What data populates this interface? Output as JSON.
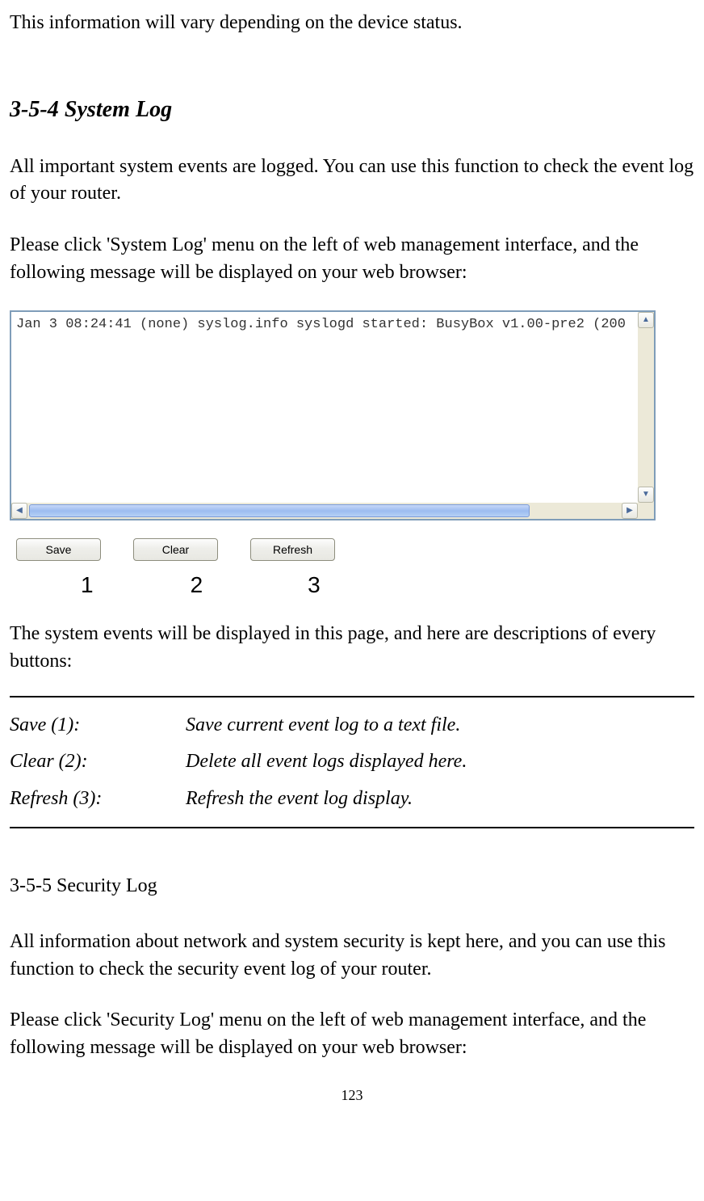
{
  "introText": "This information will vary depending on the device status.",
  "section1": {
    "heading": "3-5-4 System Log",
    "para1": "All important system events are logged. You can use this function to check the event log of your router.",
    "para2": "Please click 'System Log' menu on the left of web management interface, and the following message will be displayed on your web browser:"
  },
  "logContent": "Jan  3 08:24:41 (none) syslog.info syslogd started: BusyBox v1.00-pre2 (200",
  "buttons": {
    "save": "Save",
    "clear": "Clear",
    "refresh": "Refresh"
  },
  "annotations": {
    "n1": "1",
    "n2": "2",
    "n3": "3"
  },
  "descIntro": "The system events will be displayed in this page, and here are descriptions of every buttons:",
  "descriptions": [
    {
      "label": "Save (1):",
      "text": "Save current event log to a text file."
    },
    {
      "label": "Clear (2):",
      "text": "Delete all event logs displayed here."
    },
    {
      "label": "Refresh (3):",
      "text": "Refresh the event log display."
    }
  ],
  "section2": {
    "heading": "3-5-5 Security Log",
    "para1": "All information about network and system security is kept here, and you can use this function to check the security event log of your router.",
    "para2": "Please click 'Security Log' menu on the left of web management interface, and the following message will be displayed on your web browser:"
  },
  "pageNumber": "123"
}
